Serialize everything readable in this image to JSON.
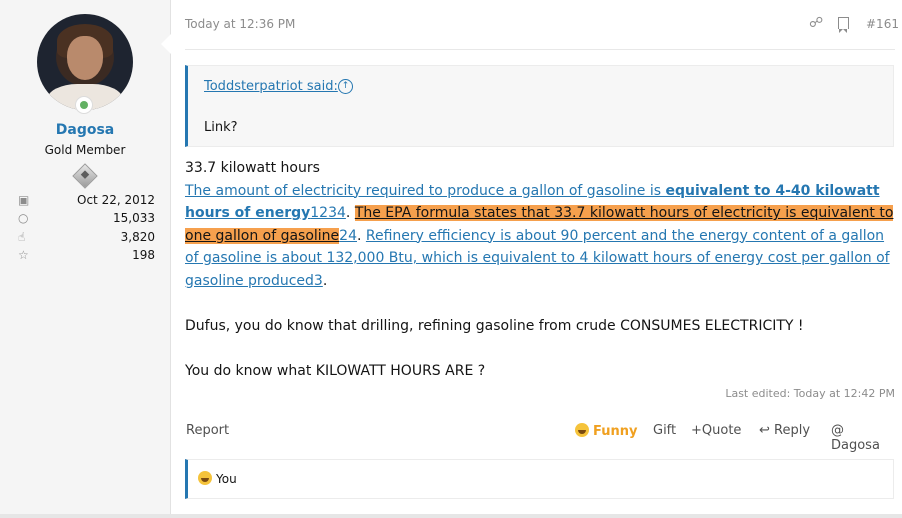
{
  "user": {
    "name": "Dagosa",
    "title": "Gold Member",
    "stats": [
      {
        "icon": "calendar-icon",
        "value": "Oct 22, 2012"
      },
      {
        "icon": "messages-icon",
        "value": "15,033"
      },
      {
        "icon": "thumbs-up-icon",
        "value": "3,820"
      },
      {
        "icon": "trophy-icon",
        "value": "198"
      }
    ]
  },
  "post": {
    "date": "Today at 12:36 PM",
    "number": "#161",
    "quote": {
      "author": "Toddsterpatriot said:",
      "text": "Link?"
    },
    "line1": "33.7 kilowatt hours",
    "link1a": "The amount of electricity required to produce a gallon of gasoline is ",
    "link1b": "equivalent to 4-40 kilowatt hours of energy",
    "ref1": "1234",
    "sep1": ". ",
    "hl": "The EPA formula states that 33.7 kilowatt hours of electricity is equivalent to one gallon of gasoline",
    "ref2": "24",
    "sep2": ". ",
    "link2": "Refinery efficiency is about 90 percent and the energy content of a gallon of gasoline is about 132,000 Btu, which is equivalent to 4 kilowatt hours of energy cost per gallon of gasoline produced",
    "ref3": "3",
    "end": ".",
    "para2": "Dufus, you do know that drilling, refining gasoline from crude CONSUMES ELECTRICITY !",
    "para3": "You do know what KILOWATT HOURS ARE ?",
    "edited": "Last edited: Today at 12:42 PM"
  },
  "actions": {
    "report": "Report",
    "funny": "Funny",
    "gift": "Gift",
    "quote": "+Quote",
    "reply": "Reply",
    "mention": "@ Dagosa"
  },
  "reactions": {
    "text": "You"
  },
  "colors": {
    "link": "#2577b1",
    "highlight": "#f6a04d",
    "funny": "#f0a020"
  }
}
